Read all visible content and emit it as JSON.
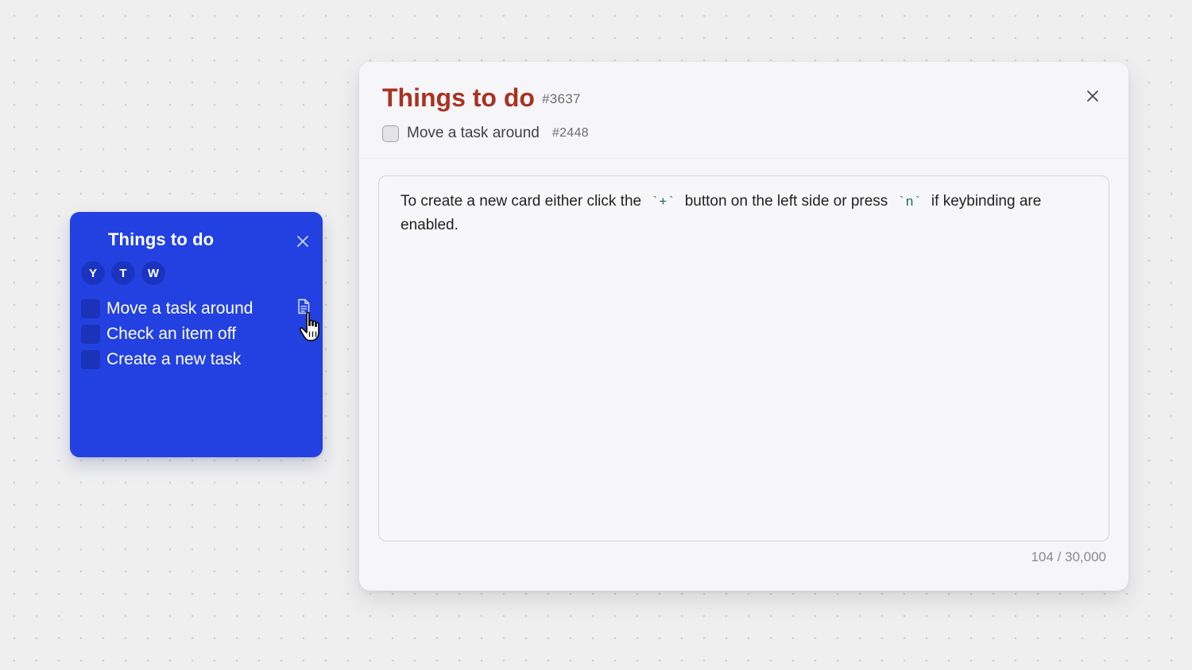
{
  "card": {
    "title": "Things to do",
    "avatars": [
      "Y",
      "T",
      "W"
    ],
    "items": [
      {
        "label": "Move a task around",
        "checked": false
      },
      {
        "label": "Check an item off",
        "checked": false
      },
      {
        "label": "Create a new task",
        "checked": false
      }
    ],
    "color": "#2341e1"
  },
  "modal": {
    "title": "Things to do",
    "id": "#3637",
    "subtask": {
      "label": "Move a task around",
      "id": "#2448",
      "checked": false
    },
    "editor": {
      "text_before": "To create a new card either click the",
      "code_plus": "`+`",
      "text_middle": "button on the left side or press",
      "code_n": "`n`",
      "text_after": "if keybinding are enabled."
    },
    "char_count": "104 / 30,000",
    "title_color": "#a83223"
  },
  "icons": {
    "card_close": "close-icon",
    "doc": "document-icon",
    "cursor": "pointer-hand-icon",
    "modal_close": "close-icon"
  }
}
